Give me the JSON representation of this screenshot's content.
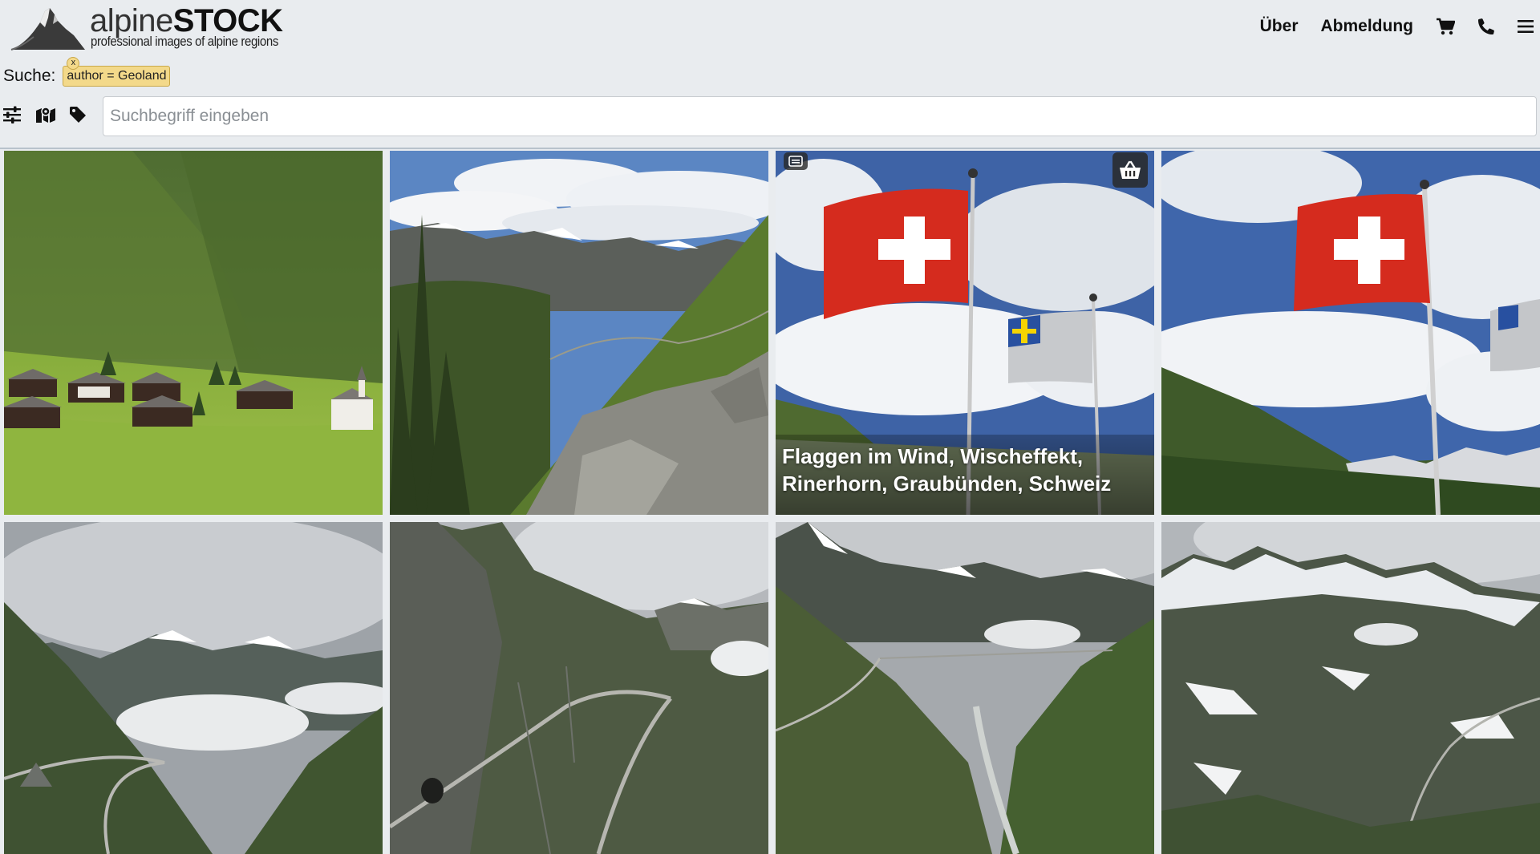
{
  "header": {
    "brand_light": "alpine",
    "brand_bold": "STOCK",
    "tagline": "professional images of alpine regions",
    "nav": {
      "about": "Über",
      "logout": "Abmeldung"
    },
    "icons": [
      "shopping-cart-icon",
      "phone-icon",
      "menu-icon"
    ]
  },
  "search": {
    "label": "Suche:",
    "filter_tag": "author = Geoland",
    "filter_remove": "x",
    "placeholder": "Suchbegriff eingeben",
    "value": ""
  },
  "toolbar": {
    "icons": [
      "sliders-icon",
      "map-icon",
      "tag-icon"
    ]
  },
  "grid": {
    "tiles": [
      {
        "scene": "alpine-village-meadow",
        "caption": ""
      },
      {
        "scene": "valley-trail-rocks",
        "caption": ""
      },
      {
        "scene": "swiss-flags-wind",
        "caption": "Flaggen im Wind, Wischeffekt, Rinerhorn, Graubünden, Schweiz",
        "selected": true,
        "icons": [
          "basket-icon",
          "collection-icon"
        ]
      },
      {
        "scene": "swiss-flags-mountains",
        "caption": ""
      },
      {
        "scene": "pass-road-clouds",
        "caption": ""
      },
      {
        "scene": "pass-road-cliff-tunnel",
        "caption": ""
      },
      {
        "scene": "valley-river-road",
        "caption": ""
      },
      {
        "scene": "snowy-pass-road",
        "caption": ""
      }
    ]
  },
  "colors": {
    "background": "#e9ecef",
    "tag": "#f3d98a",
    "selection": "#4a5aa8",
    "swiss_red": "#d52b1e"
  }
}
